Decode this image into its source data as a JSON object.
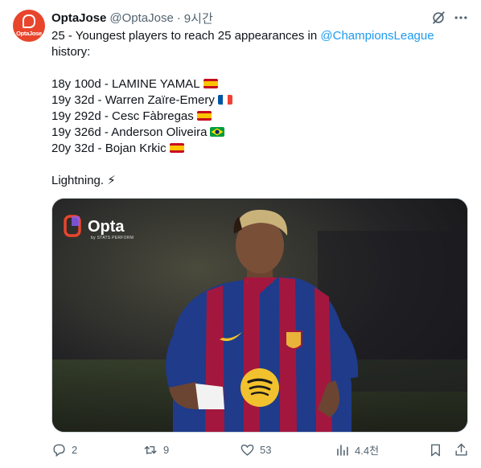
{
  "author": {
    "avatar_text": "OptaJose",
    "display_name": "OptaJose",
    "handle": "@OptaJose",
    "separator": "·",
    "time": "9시간"
  },
  "tweet": {
    "line1_prefix": "25 - Youngest players to reach 25 appearances in ",
    "line1_mention": "@ChampionsLeague",
    "line2": "history:",
    "list": [
      {
        "text": "18y 100d - LAMINE YAMAL",
        "flag": "spain"
      },
      {
        "text": "19y 32d - Warren Zaïre-Emery",
        "flag": "france"
      },
      {
        "text": "19y 292d - Cesc Fàbregas",
        "flag": "spain"
      },
      {
        "text": "19y 326d - Anderson Oliveira",
        "flag": "brazil"
      },
      {
        "text": "20y 32d - Bojan Krkic",
        "flag": "spain"
      }
    ],
    "closing": "Lightning. ⚡"
  },
  "media": {
    "logo_text": "Opta",
    "logo_subtext": "by STATS PERFORM",
    "sponsor_alt": "spotify-logo"
  },
  "actions": {
    "replies": "2",
    "retweets": "9",
    "likes": "53",
    "views": "4.4천"
  },
  "colors": {
    "accent": "#1d9bf0",
    "text_secondary": "#536471",
    "avatar_bg": "#e8452c",
    "barca_blue": "#1f3b8a",
    "barca_red": "#a3173f"
  }
}
